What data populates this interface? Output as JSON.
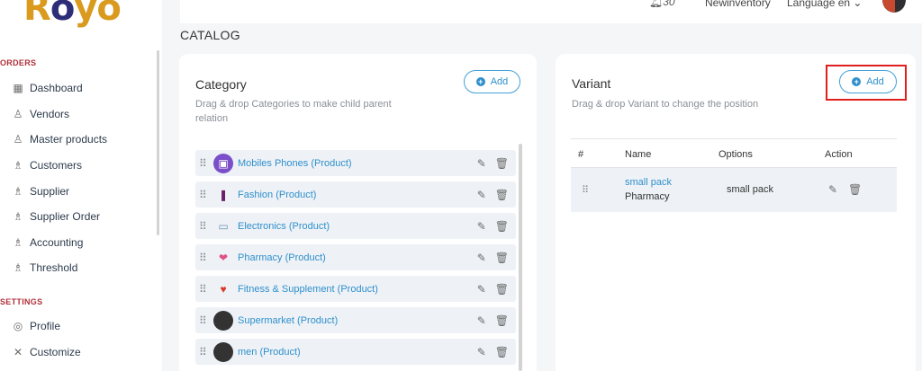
{
  "brand": {
    "logo_part1": "R",
    "logo_part2": "o",
    "logo_part3": "yo"
  },
  "topbar": {
    "bell_count": "30",
    "store_name": "Newinventory",
    "language": "Language en",
    "language_chevron": "⌄"
  },
  "page": {
    "title": "CATALOG"
  },
  "sidebar": {
    "orders_label": "ORDERS",
    "settings_label": "SETTINGS",
    "items": [
      {
        "label": "Dashboard",
        "icon": "dashboard-icon",
        "glyph": "▦"
      },
      {
        "label": "Vendors",
        "icon": "vendors-icon",
        "glyph": "♙"
      },
      {
        "label": "Master products",
        "icon": "master-products-icon",
        "glyph": "♙"
      },
      {
        "label": "Customers",
        "icon": "customers-icon",
        "glyph": "♗"
      },
      {
        "label": "Supplier",
        "icon": "supplier-icon",
        "glyph": "♗"
      },
      {
        "label": "Supplier Order",
        "icon": "supplier-order-icon",
        "glyph": "♗"
      },
      {
        "label": "Accounting",
        "icon": "accounting-icon",
        "glyph": "♗"
      },
      {
        "label": "Threshold",
        "icon": "threshold-icon",
        "glyph": "♗"
      }
    ],
    "settings_items": [
      {
        "label": "Profile",
        "icon": "profile-icon",
        "glyph": "◎"
      },
      {
        "label": "Customize",
        "icon": "customize-icon",
        "glyph": "✕"
      }
    ]
  },
  "category": {
    "title": "Category",
    "subtitle": "Drag & drop Categories to make child parent relation",
    "add_label": "Add",
    "rows": [
      {
        "name": "Mobiles Phones (Product)",
        "thumb_color": "#7b4fc9",
        "glyph": "▣"
      },
      {
        "name": "Fashion (Product)",
        "thumb_color": "#ffffff",
        "glyph": "❚"
      },
      {
        "name": "Electronics (Product)",
        "thumb_color": "#ffffff",
        "glyph": "▭"
      },
      {
        "name": "Pharmacy (Product)",
        "thumb_color": "#ffffff",
        "glyph": "❤"
      },
      {
        "name": "Fitness & Supplement (Product)",
        "thumb_color": "#ffffff",
        "glyph": "♥"
      },
      {
        "name": "Supermarket (Product)",
        "thumb_color": "#333333",
        "glyph": ""
      },
      {
        "name": "men (Product)",
        "thumb_color": "#333333",
        "glyph": ""
      }
    ]
  },
  "variant": {
    "title": "Variant",
    "subtitle": "Drag & drop Variant to change the position",
    "add_label": "Add",
    "columns": [
      "#",
      "Name",
      "Options",
      "Action"
    ],
    "rows": [
      {
        "name": "small pack",
        "category": "Pharmacy",
        "options": "small pack"
      }
    ]
  }
}
